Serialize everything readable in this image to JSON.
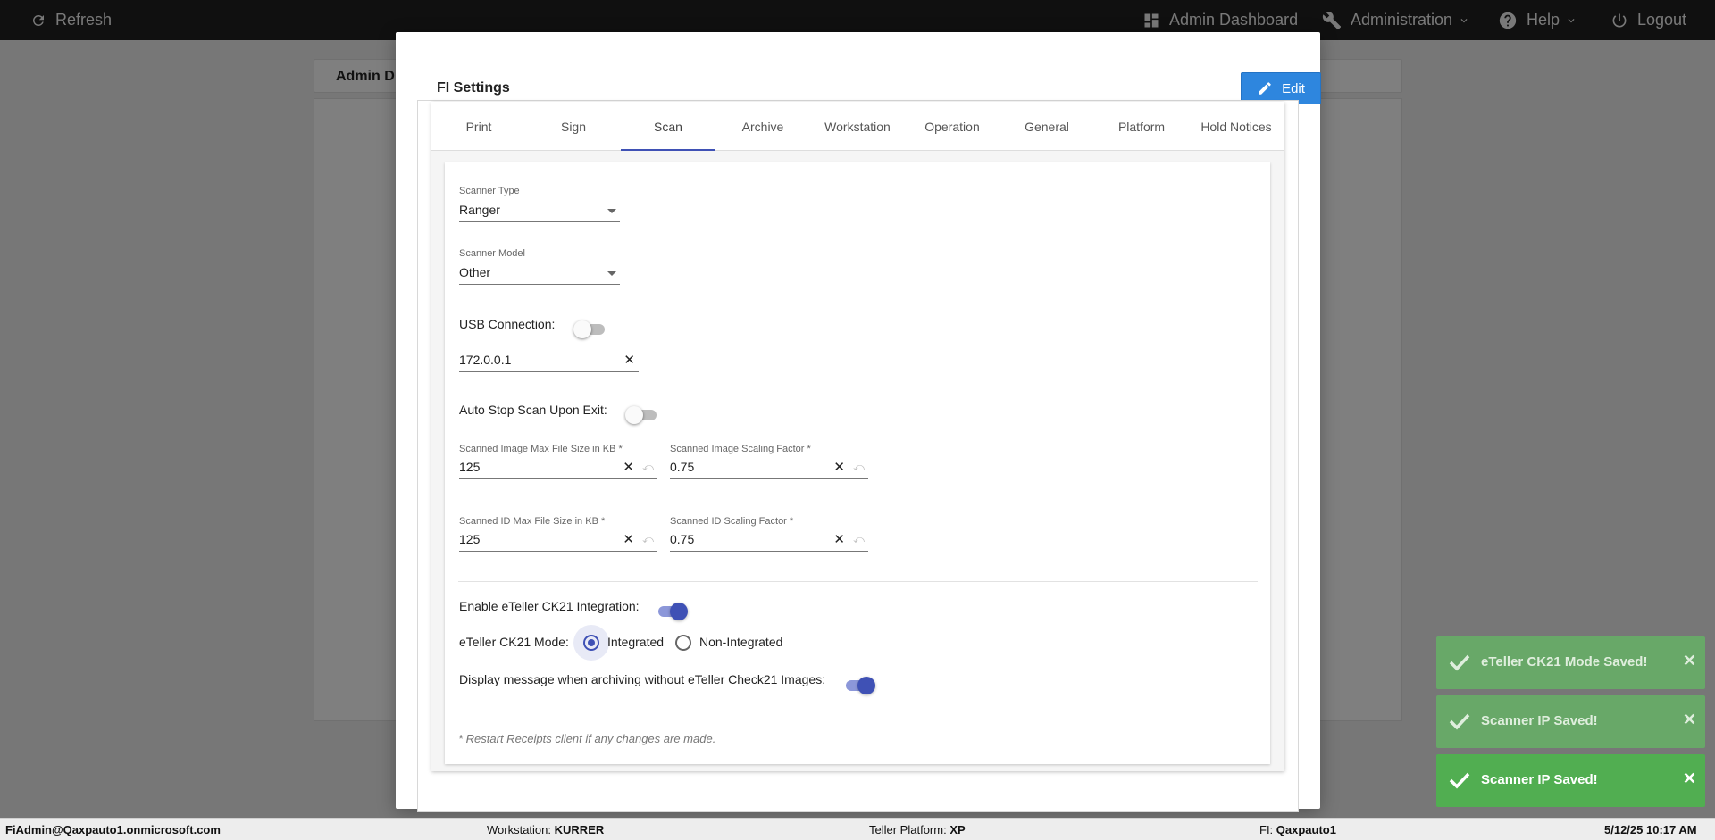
{
  "topbar": {
    "refresh_label": "Refresh",
    "admin_dashboard_label": "Admin Dashboard",
    "administration_label": "Administration",
    "help_label": "Help",
    "logout_label": "Logout"
  },
  "background": {
    "card_title": "Admin D"
  },
  "modal": {
    "title": "FI Settings",
    "edit_label": "Edit",
    "tabs": [
      {
        "label": "Print"
      },
      {
        "label": "Sign"
      },
      {
        "label": "Scan"
      },
      {
        "label": "Archive"
      },
      {
        "label": "Workstation"
      },
      {
        "label": "Operation"
      },
      {
        "label": "General"
      },
      {
        "label": "Platform"
      },
      {
        "label": "Hold Notices"
      }
    ],
    "active_tab": "Scan",
    "scan": {
      "scanner_type_label": "Scanner Type",
      "scanner_type_value": "Ranger",
      "scanner_model_label": "Scanner Model",
      "scanner_model_value": "Other",
      "usb_connection_label": "USB Connection:",
      "usb_connection_on": false,
      "ip_value": "172.0.0.1",
      "auto_stop_label": "Auto Stop Scan Upon Exit:",
      "auto_stop_on": false,
      "image_max_size_label": "Scanned Image Max File Size in KB *",
      "image_max_size_value": "125",
      "image_scaling_label": "Scanned Image Scaling Factor *",
      "image_scaling_value": "0.75",
      "id_max_size_label": "Scanned ID Max File Size in KB *",
      "id_max_size_value": "125",
      "id_scaling_label": "Scanned ID Scaling Factor *",
      "id_scaling_value": "0.75",
      "ck21_enable_label": "Enable eTeller CK21 Integration:",
      "ck21_enable_on": true,
      "ck21_mode_label": "eTeller CK21 Mode:",
      "ck21_mode_options": [
        "Integrated",
        "Non-Integrated"
      ],
      "ck21_mode_selected": "Integrated",
      "display_message_label": "Display message when archiving without eTeller Check21 Images:",
      "display_message_on": true,
      "restart_note": "* Restart Receipts client if any changes are made."
    }
  },
  "toasts": [
    {
      "message": "eTeller CK21 Mode Saved!"
    },
    {
      "message": "Scanner IP Saved!"
    },
    {
      "message": "Scanner IP Saved!"
    }
  ],
  "colors": {
    "accent": "#3f51b5",
    "edit_button": "#2e86de",
    "toast_success": "#51ae51"
  },
  "statusbar": {
    "user": "FiAdmin@Qaxpauto1.onmicrosoft.com",
    "workstation_label": "Workstation:",
    "workstation_value": "KURRER",
    "platform_label": "Teller Platform:",
    "platform_value": "XP",
    "fi_label": "FI:",
    "fi_value": "Qaxpauto1",
    "datetime": "5/12/25 10:17 AM"
  }
}
